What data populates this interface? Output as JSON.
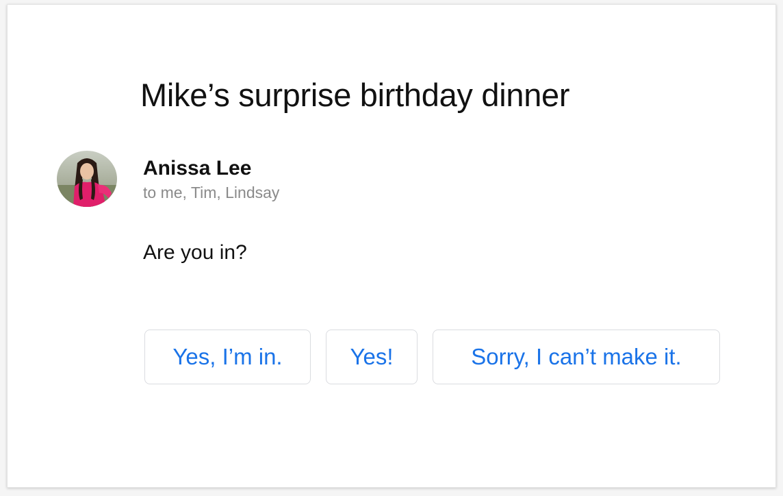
{
  "message": {
    "subject": "Mike’s surprise birthday dinner",
    "sender": {
      "name": "Anissa Lee",
      "recipients": "to me, Tim, Lindsay",
      "avatar_icon": "avatar-photo"
    },
    "body": "Are you in?"
  },
  "smart_replies": [
    {
      "label": "Yes, I’m in."
    },
    {
      "label": "Yes!"
    },
    {
      "label": "Sorry, I can’t make it."
    }
  ],
  "colors": {
    "accent": "#1a73e8",
    "button_border": "#dadce0",
    "secondary_text": "#8a8a8a",
    "primary_text": "#111111"
  }
}
